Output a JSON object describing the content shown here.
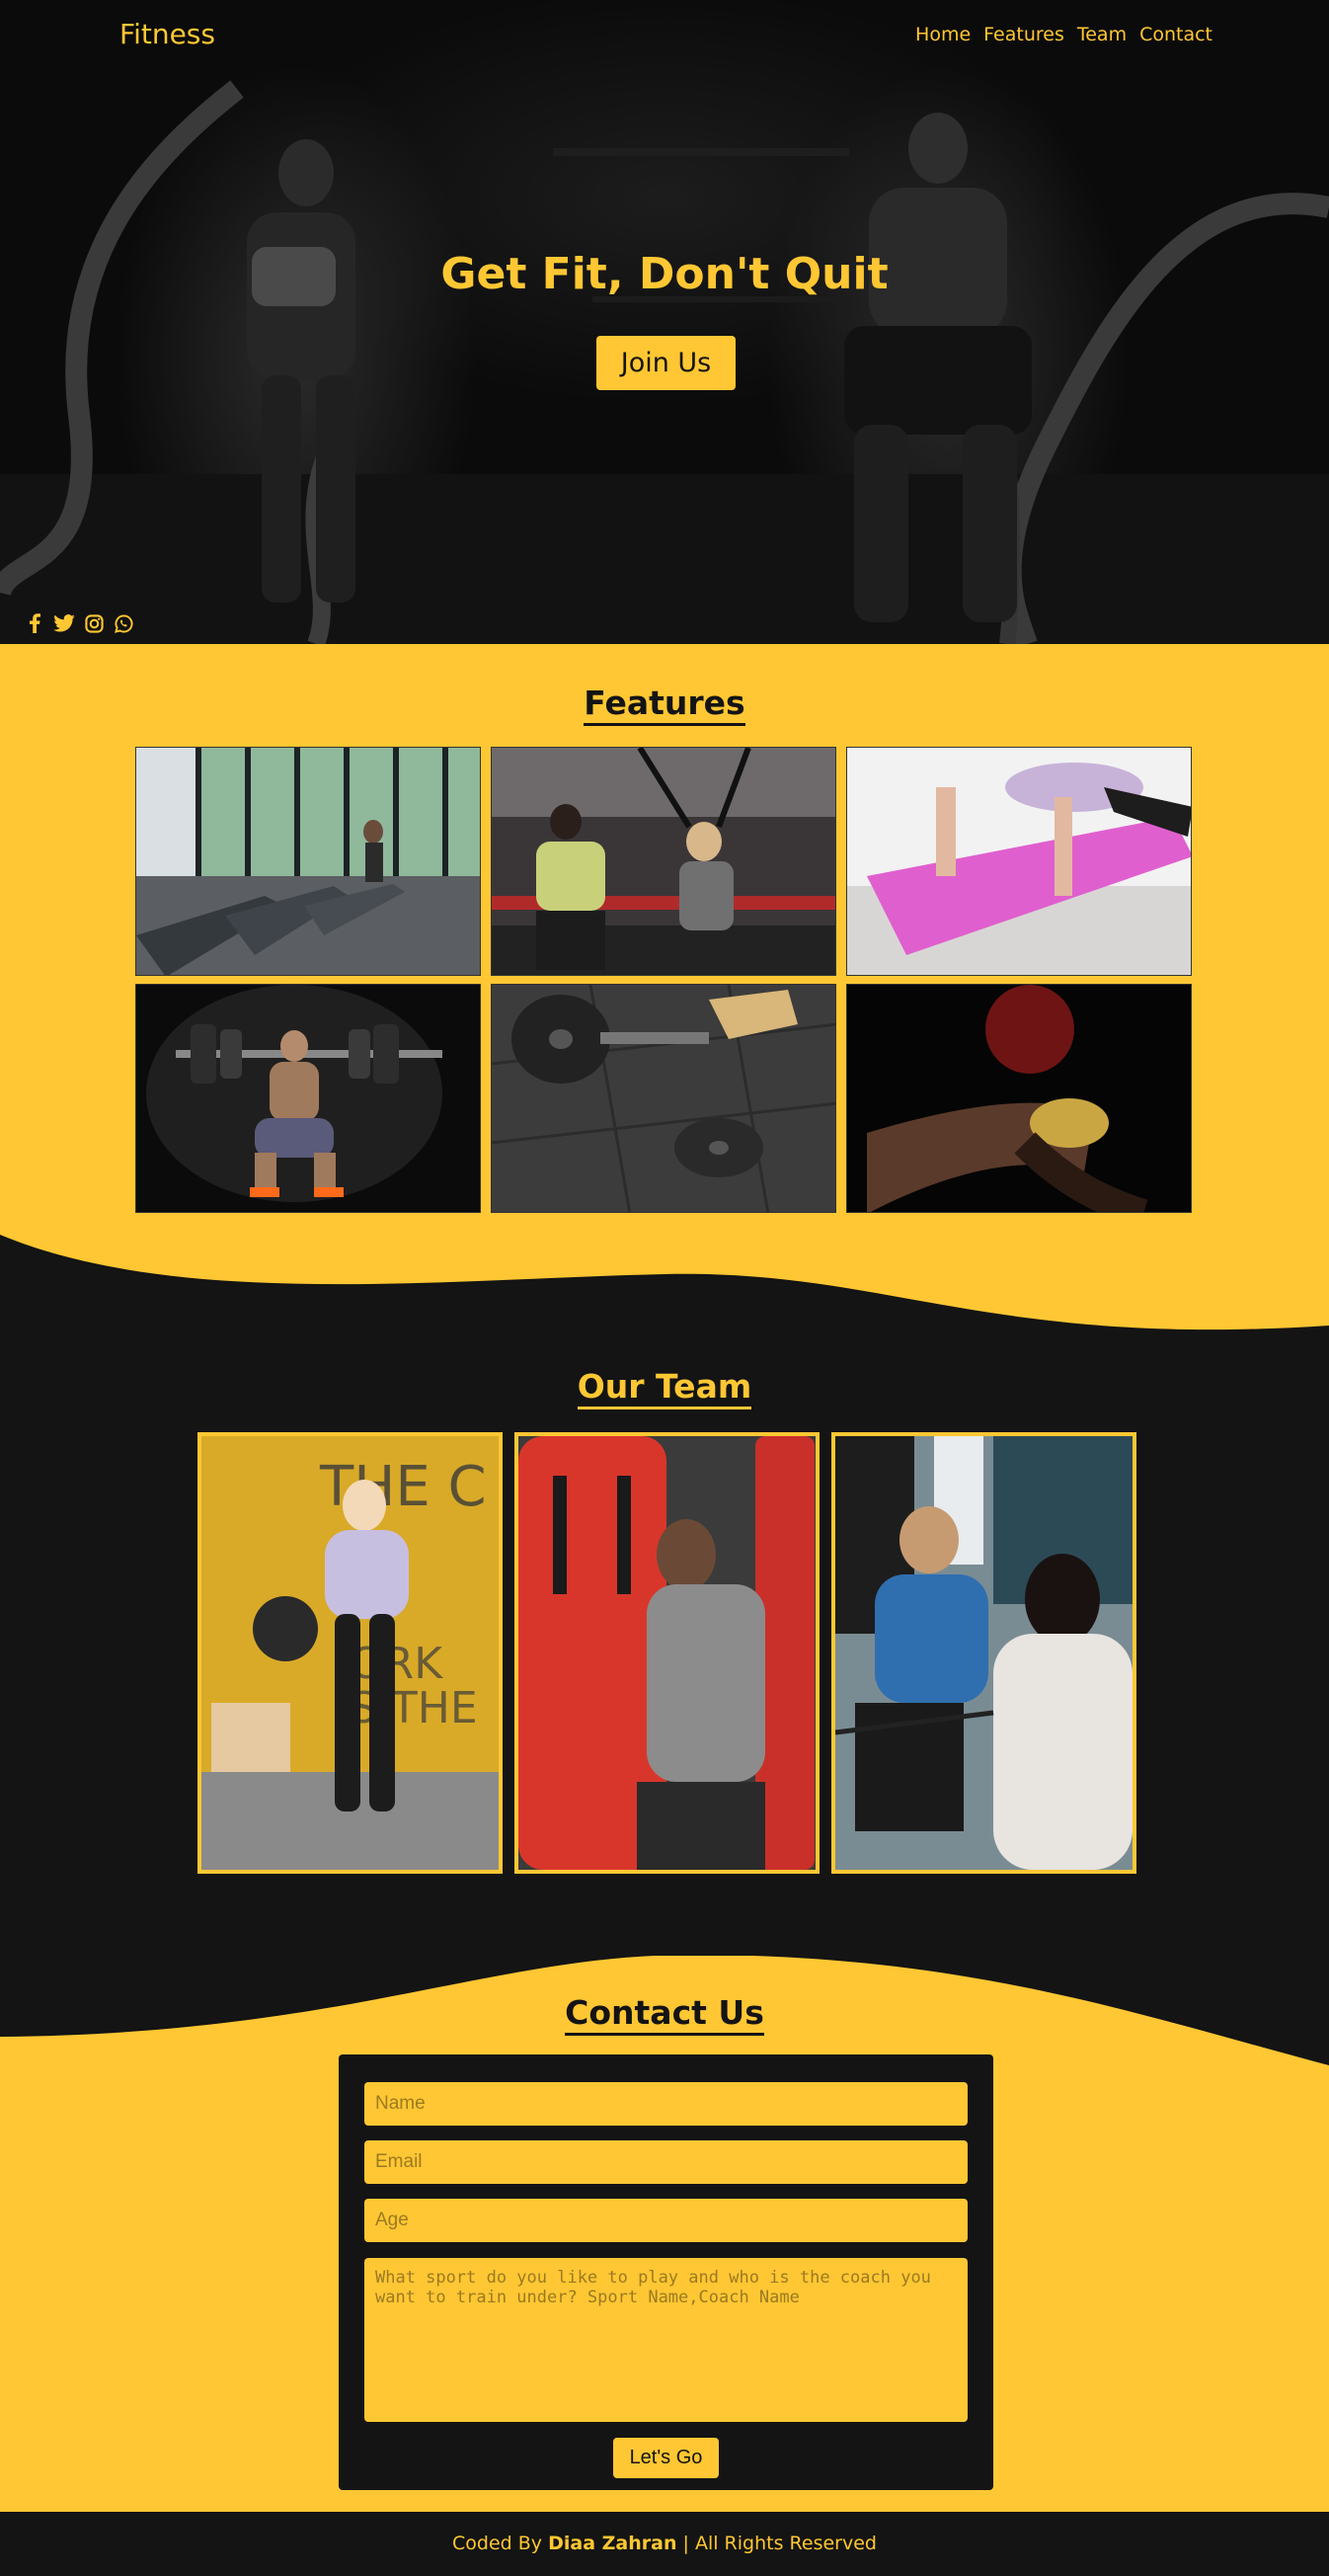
{
  "nav": {
    "brand": "Fitness",
    "items": [
      {
        "label": "Home"
      },
      {
        "label": "Features"
      },
      {
        "label": "Team"
      },
      {
        "label": "Contact"
      }
    ]
  },
  "hero": {
    "headline": "Get Fit, Don't Quit",
    "cta_label": "Join Us",
    "social_icons": [
      "facebook-icon",
      "twitter-icon",
      "instagram-icon",
      "whatsapp-icon"
    ]
  },
  "features": {
    "title": "Features"
  },
  "team": {
    "title": "Our Team"
  },
  "contact": {
    "title": "Contact Us",
    "name_placeholder": "Name",
    "email_placeholder": "Email",
    "age_placeholder": "Age",
    "message_placeholder": "What sport do you like to play and who is the coach you want to train under? Sport Name,Coach Name",
    "submit_label": "Let's Go"
  },
  "footer": {
    "prefix": "Coded By ",
    "author": "Diaa Zahran",
    "suffix": " | All Rights Reserved"
  },
  "colors": {
    "accent": "#ffc733",
    "dark": "#141414"
  }
}
